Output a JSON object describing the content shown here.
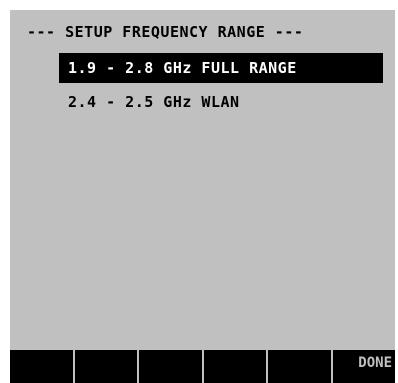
{
  "screen": {
    "title": "--- SETUP FREQUENCY RANGE ---",
    "options": [
      {
        "label": "1.9 - 2.8 GHz FULL RANGE",
        "selected": true
      },
      {
        "label": "2.4 - 2.5 GHz WLAN",
        "selected": false
      }
    ]
  },
  "softkeys": [
    "",
    "",
    "",
    "",
    "",
    "DONE"
  ],
  "colors": {
    "screen_bg": "#c0c0c0",
    "highlight_bg": "#000000",
    "highlight_text": "#ffffff",
    "text": "#000000",
    "softkey_bg": "#000000",
    "softkey_text": "#c0c0c0"
  }
}
